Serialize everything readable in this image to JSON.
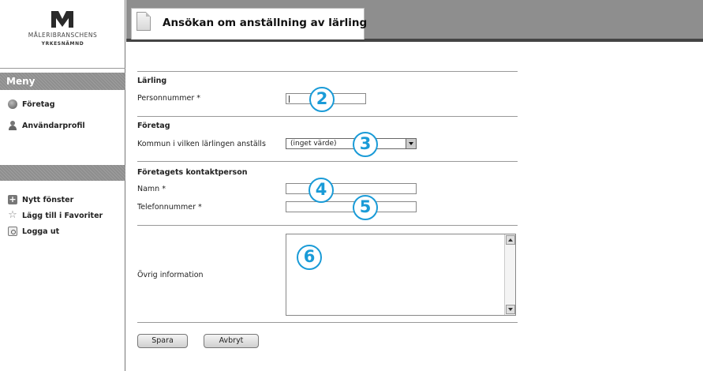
{
  "brand": {
    "name": "MÅLERIBRANSCHENS",
    "subtitle": "YRKESNÄMND"
  },
  "sidebar": {
    "menu_title": "Meny",
    "items": [
      {
        "label": "Företag",
        "icon": "globe-icon"
      },
      {
        "label": "Användarprofil",
        "icon": "user-icon"
      }
    ],
    "tools": [
      {
        "label": "Nytt fönster",
        "icon": "new-window-icon"
      },
      {
        "label": "Lägg till i Favoriter",
        "icon": "star-icon"
      },
      {
        "label": "Logga ut",
        "icon": "logout-icon"
      }
    ]
  },
  "header": {
    "title": "Ansökan om anställning av lärling"
  },
  "form": {
    "sections": {
      "apprentice": "Lärling",
      "company": "Företag",
      "contact": "Företagets kontaktperson"
    },
    "labels": {
      "personnummer": "Personnummer *",
      "kommun": "Kommun i vilken lärlingen anställs",
      "namn": "Namn *",
      "telefon": "Telefonnummer *",
      "ovrig": "Övrig information"
    },
    "values": {
      "personnummer": "",
      "kommun": "(inget värde)",
      "namn": "",
      "telefon": "",
      "ovrig": ""
    },
    "buttons": {
      "save": "Spara",
      "cancel": "Avbryt"
    }
  },
  "callouts": [
    "2",
    "3",
    "4",
    "5",
    "6"
  ],
  "colors": {
    "callout": "#1a9bd7",
    "menu_bar": "#8e8e8e"
  }
}
